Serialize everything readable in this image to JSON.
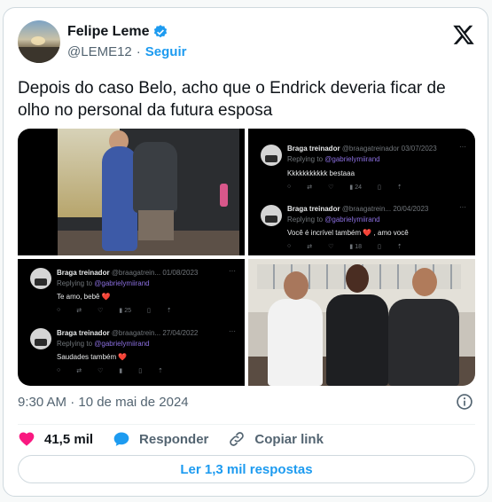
{
  "author": {
    "name": "Felipe Leme",
    "handle": "@LEME12",
    "separator": "·",
    "follow_label": "Seguir",
    "verified": true
  },
  "tweet": {
    "text": "Depois do caso Belo, acho que o Endrick deveria ficar de olho no personal da futura esposa",
    "timestamp": "9:30 AM · 10 de mai de 2024"
  },
  "media": {
    "replies": [
      {
        "name": "Braga treinador",
        "handle": "@braagatreinador",
        "date": "03/07/2023",
        "replying_prefix": "Replying to",
        "replying_to": "@gabrielymiirand",
        "text": "Kkkkkkkkkkk bestaaa",
        "views": "24"
      },
      {
        "name": "Braga treinador",
        "handle": "@braagatrein...",
        "date": "20/04/2023",
        "replying_prefix": "Replying to",
        "replying_to": "@gabrielymiirand",
        "text": "Você é incrível também ❤️ , amo você",
        "views": "18"
      },
      {
        "name": "Braga treinador",
        "handle": "@braagatrein...",
        "date": "01/08/2023",
        "replying_prefix": "Replying to",
        "replying_to": "@gabrielymiirand",
        "text": "Te amo, bebê ❤️",
        "views": "25"
      },
      {
        "name": "Braga treinador",
        "handle": "@braagatrein...",
        "date": "27/04/2022",
        "replying_prefix": "Replying to",
        "replying_to": "@gabrielymiirand",
        "text": "Saudades também ❤️",
        "views": ""
      }
    ]
  },
  "actions": {
    "likes": "41,5 mil",
    "reply_label": "Responder",
    "copy_link_label": "Copiar link",
    "read_replies_label": "Ler 1,3 mil respostas"
  },
  "colors": {
    "accent": "#1d9bf0",
    "like": "#f91880",
    "muted": "#536471"
  },
  "icons": [
    "verified-badge-icon",
    "x-logo-icon",
    "info-icon",
    "heart-icon",
    "reply-bubble-icon",
    "link-icon"
  ]
}
